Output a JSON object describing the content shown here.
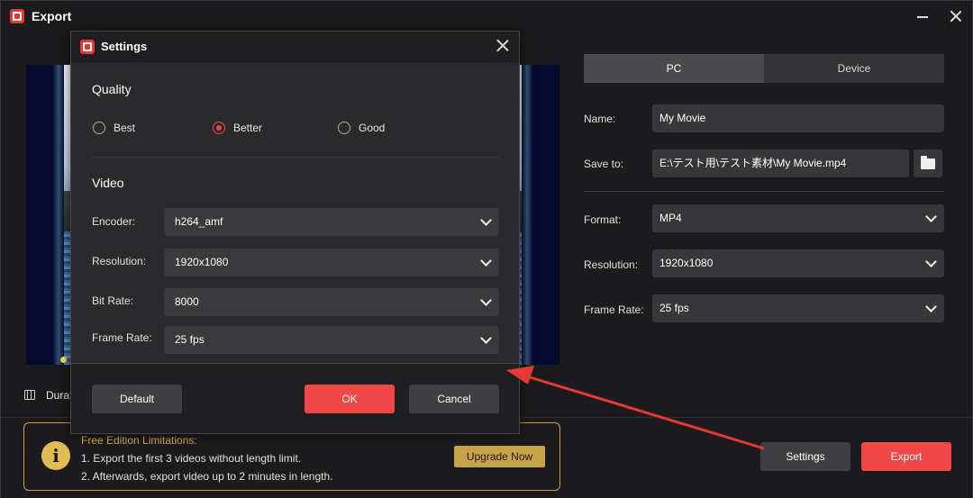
{
  "window": {
    "title": "Export"
  },
  "preview": {
    "duration_label": "Durat"
  },
  "right_panel": {
    "tabs": [
      {
        "label": "PC",
        "active": true
      },
      {
        "label": "Device",
        "active": false
      }
    ],
    "name": {
      "label": "Name:",
      "value": "My Movie"
    },
    "save_to": {
      "label": "Save to:",
      "value": "E:\\テスト用\\テスト素材\\My Movie.mp4"
    },
    "format": {
      "label": "Format:",
      "value": "MP4"
    },
    "resolution": {
      "label": "Resolution:",
      "value": "1920x1080"
    },
    "frame_rate": {
      "label": "Frame Rate:",
      "value": "25 fps"
    }
  },
  "limitations": {
    "title": "Free Edition Limitations:",
    "line1": "1. Export the first 3 videos without length limit.",
    "line2": "2. Afterwards, export video up to 2 minutes in length.",
    "upgrade_label": "Upgrade Now"
  },
  "actions": {
    "settings_label": "Settings",
    "export_label": "Export"
  },
  "settings_dialog": {
    "title": "Settings",
    "quality_title": "Quality",
    "quality_options": [
      {
        "label": "Best",
        "selected": false
      },
      {
        "label": "Better",
        "selected": true
      },
      {
        "label": "Good",
        "selected": false
      }
    ],
    "video_title": "Video",
    "encoder": {
      "label": "Encoder:",
      "value": "h264_amf"
    },
    "resolution": {
      "label": "Resolution:",
      "value": "1920x1080"
    },
    "bit_rate": {
      "label": "Bit Rate:",
      "value": "8000"
    },
    "frame_rate": {
      "label": "Frame Rate:",
      "value": "25 fps"
    },
    "default_label": "Default",
    "ok_label": "OK",
    "cancel_label": "Cancel"
  },
  "colors": {
    "accent": "#f04848",
    "warning": "#c9a34a",
    "annotation_arrow": "#e53935"
  }
}
